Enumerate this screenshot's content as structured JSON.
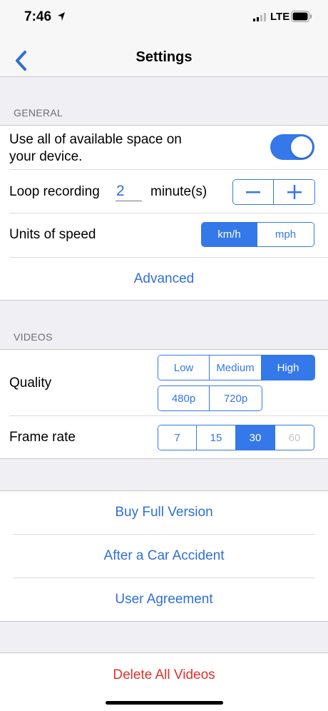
{
  "status": {
    "time": "7:46",
    "network": "LTE"
  },
  "nav": {
    "title": "Settings"
  },
  "general": {
    "header": "GENERAL",
    "use_space_label_line1": "Use all of available space on",
    "use_space_label_line2": "your device.",
    "use_space_on": true,
    "loop_label": "Loop recording",
    "loop_value": "2",
    "loop_unit": "minute(s)",
    "minus": "—",
    "plus": "+",
    "speed_label": "Units of speed",
    "speed_options": [
      "km/h",
      "mph"
    ],
    "speed_selected": "km/h",
    "advanced": "Advanced"
  },
  "videos": {
    "header": "VIDEOS",
    "quality_label": "Quality",
    "quality_options": [
      "Low",
      "Medium",
      "High"
    ],
    "quality_selected": "High",
    "resolution_options": [
      "480p",
      "720p"
    ],
    "framerate_label": "Frame rate",
    "framerate_options": [
      "7",
      "15",
      "30",
      "60"
    ],
    "framerate_selected": "30"
  },
  "links": {
    "buy": "Buy Full Version",
    "accident": "After a Car Accident",
    "agreement": "User Agreement"
  },
  "danger": {
    "delete": "Delete All Videos"
  },
  "colors": {
    "accent": "#3478e9",
    "link": "#2f6fd4",
    "danger": "#e0322c"
  }
}
